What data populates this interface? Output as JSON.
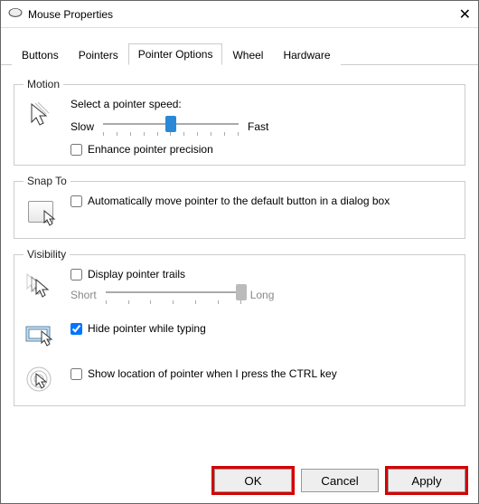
{
  "window": {
    "title": "Mouse Properties"
  },
  "tabs": {
    "buttons": "Buttons",
    "pointers": "Pointers",
    "pointer_options": "Pointer Options",
    "wheel": "Wheel",
    "hardware": "Hardware"
  },
  "motion": {
    "legend": "Motion",
    "prompt": "Select a pointer speed:",
    "slow": "Slow",
    "fast": "Fast",
    "enhance": "Enhance pointer precision"
  },
  "snapto": {
    "legend": "Snap To",
    "auto": "Automatically move pointer to the default button in a dialog box"
  },
  "visibility": {
    "legend": "Visibility",
    "trails": "Display pointer trails",
    "short": "Short",
    "long": "Long",
    "hide": "Hide pointer while typing",
    "ctrl": "Show location of pointer when I press the CTRL key"
  },
  "buttons": {
    "ok": "OK",
    "cancel": "Cancel",
    "apply": "Apply"
  }
}
